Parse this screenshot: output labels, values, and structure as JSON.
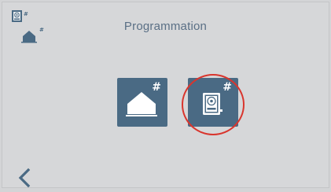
{
  "header": {
    "title": "Programmation"
  },
  "corner": {
    "monitor_icon": "monitor-hash-icon",
    "home_icon": "home-hash-icon",
    "hash_label": "#"
  },
  "tiles": [
    {
      "name": "home-config",
      "icon": "home-icon",
      "hash": "#"
    },
    {
      "name": "monitor-config",
      "icon": "monitor-icon",
      "hash": "#",
      "selected": true
    }
  ],
  "footer": {
    "back_icon": "chevron-left-icon"
  },
  "colors": {
    "tile": "#4a6a84",
    "highlight": "#d9352d",
    "title": "#5a6f85",
    "background": "#d6d7d9"
  }
}
